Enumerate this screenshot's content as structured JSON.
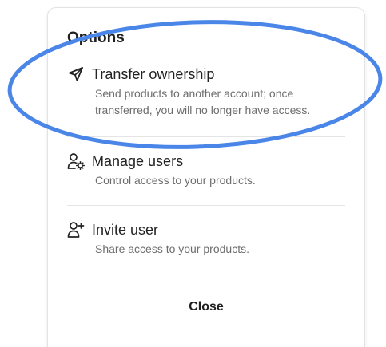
{
  "sheet": {
    "title": "Options",
    "options": [
      {
        "label": "Transfer ownership",
        "icon": "send-icon",
        "description_line1": "Send products to another account; once",
        "description_line2": "transferred, you will no longer have access."
      },
      {
        "label": "Manage users",
        "icon": "user-settings-icon",
        "description_line1": "Control access to your products."
      },
      {
        "label": "Invite user",
        "icon": "user-plus-icon",
        "description_line1": "Share access to your products."
      }
    ],
    "close_label": "Close"
  },
  "colors": {
    "highlight": "#4a86e8",
    "text": "#222222",
    "muted": "#6d6d6d",
    "divider": "#e4e4e4"
  }
}
